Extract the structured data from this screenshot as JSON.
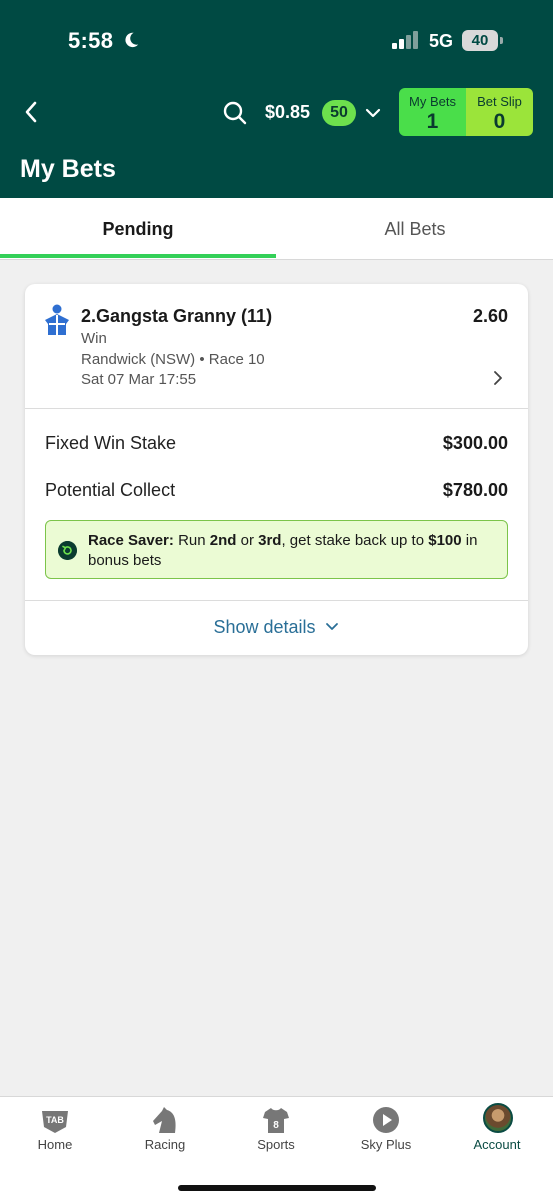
{
  "status_bar": {
    "time": "5:58",
    "network": "5G",
    "battery": "40"
  },
  "header": {
    "balance": "$0.85",
    "bonus_count": "50",
    "my_bets": {
      "label": "My Bets",
      "count": "1"
    },
    "bet_slip": {
      "label": "Bet Slip",
      "count": "0"
    },
    "title": "My Bets"
  },
  "tabs": [
    {
      "label": "Pending",
      "active": true
    },
    {
      "label": "All Bets",
      "active": false
    }
  ],
  "bet": {
    "runner": "2.Gangsta Granny (11)",
    "odds": "2.60",
    "bet_type": "Win",
    "venue": "Randwick (NSW) • Race 10",
    "date": "Sat 07 Mar 17:55",
    "stake_label": "Fixed Win Stake",
    "stake_value": "$300.00",
    "collect_label": "Potential Collect",
    "collect_value": "$780.00",
    "promo": {
      "title": "Race Saver:",
      "text_1": " Run ",
      "bold_1": "2nd",
      "text_2": " or ",
      "bold_2": "3rd",
      "text_3": ", get stake back up to ",
      "bold_3": "$100",
      "text_4": " in bonus bets"
    },
    "show_details": "Show details"
  },
  "bottom_nav": [
    {
      "label": "Home",
      "icon": "tab-logo-icon"
    },
    {
      "label": "Racing",
      "icon": "horse-head-icon"
    },
    {
      "label": "Sports",
      "icon": "jersey-icon"
    },
    {
      "label": "Sky Plus",
      "icon": "play-icon"
    },
    {
      "label": "Account",
      "icon": "avatar"
    }
  ],
  "colors": {
    "header_bg": "#004a43",
    "accent_green": "#34d058",
    "link_blue": "#2a6f97"
  }
}
